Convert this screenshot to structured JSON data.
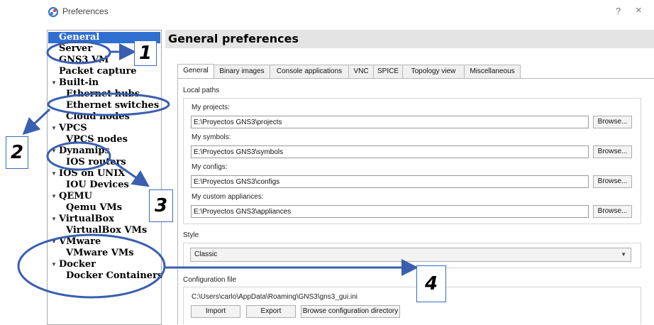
{
  "window": {
    "title": "Preferences",
    "help_glyph": "?",
    "close_glyph": "×"
  },
  "sidebar": {
    "items": [
      {
        "label": "General",
        "level": "top",
        "expandable": false,
        "selected": true
      },
      {
        "label": "Server",
        "level": "top",
        "expandable": false
      },
      {
        "label": "GNS3 VM",
        "level": "top",
        "expandable": false
      },
      {
        "label": "Packet capture",
        "level": "top",
        "expandable": false
      },
      {
        "label": "Built-in",
        "level": "top",
        "expandable": true
      },
      {
        "label": "Ethernet hubs",
        "level": "child"
      },
      {
        "label": "Ethernet switches",
        "level": "child"
      },
      {
        "label": "Cloud nodes",
        "level": "child"
      },
      {
        "label": "VPCS",
        "level": "top",
        "expandable": true
      },
      {
        "label": "VPCS nodes",
        "level": "child"
      },
      {
        "label": "Dynamips",
        "level": "top",
        "expandable": true
      },
      {
        "label": "IOS routers",
        "level": "child"
      },
      {
        "label": "IOS on UNIX",
        "level": "top",
        "expandable": true
      },
      {
        "label": "IOU Devices",
        "level": "child"
      },
      {
        "label": "QEMU",
        "level": "top",
        "expandable": true
      },
      {
        "label": "Qemu VMs",
        "level": "child"
      },
      {
        "label": "VirtualBox",
        "level": "top",
        "expandable": true
      },
      {
        "label": "VirtualBox VMs",
        "level": "child"
      },
      {
        "label": "VMware",
        "level": "top",
        "expandable": true
      },
      {
        "label": "VMware VMs",
        "level": "child"
      },
      {
        "label": "Docker",
        "level": "top",
        "expandable": true
      },
      {
        "label": "Docker Containers",
        "level": "child"
      }
    ]
  },
  "main": {
    "title": "General preferences",
    "tabs": [
      {
        "label": "General",
        "active": true
      },
      {
        "label": "Binary images"
      },
      {
        "label": "Console applications"
      },
      {
        "label": "VNC"
      },
      {
        "label": "SPICE"
      },
      {
        "label": "Topology view"
      },
      {
        "label": "Miscellaneous"
      }
    ],
    "local_paths": {
      "group_label": "Local paths",
      "browse_label": "Browse...",
      "fields": [
        {
          "label": "My projects:",
          "value": "E:\\Proyectos GNS3\\projects"
        },
        {
          "label": "My symbols:",
          "value": "E:\\Proyectos GNS3\\symbols"
        },
        {
          "label": "My configs:",
          "value": "E:\\Proyectos GNS3\\configs"
        },
        {
          "label": "My custom appliances:",
          "value": "E:\\Proyectos GNS3\\appliances"
        }
      ]
    },
    "style": {
      "group_label": "Style",
      "selected": "Classic"
    },
    "config_file": {
      "group_label": "Configuration file",
      "path": "C:\\Users\\carlo\\AppData\\Roaming\\GNS3\\gns3_gui.ini",
      "import_label": "Import",
      "export_label": "Export",
      "browse_dir_label": "Browse configuration directory"
    }
  },
  "annotations": {
    "accent_color": "#3a5fb0",
    "callouts": [
      "1",
      "2",
      "3",
      "4"
    ]
  }
}
